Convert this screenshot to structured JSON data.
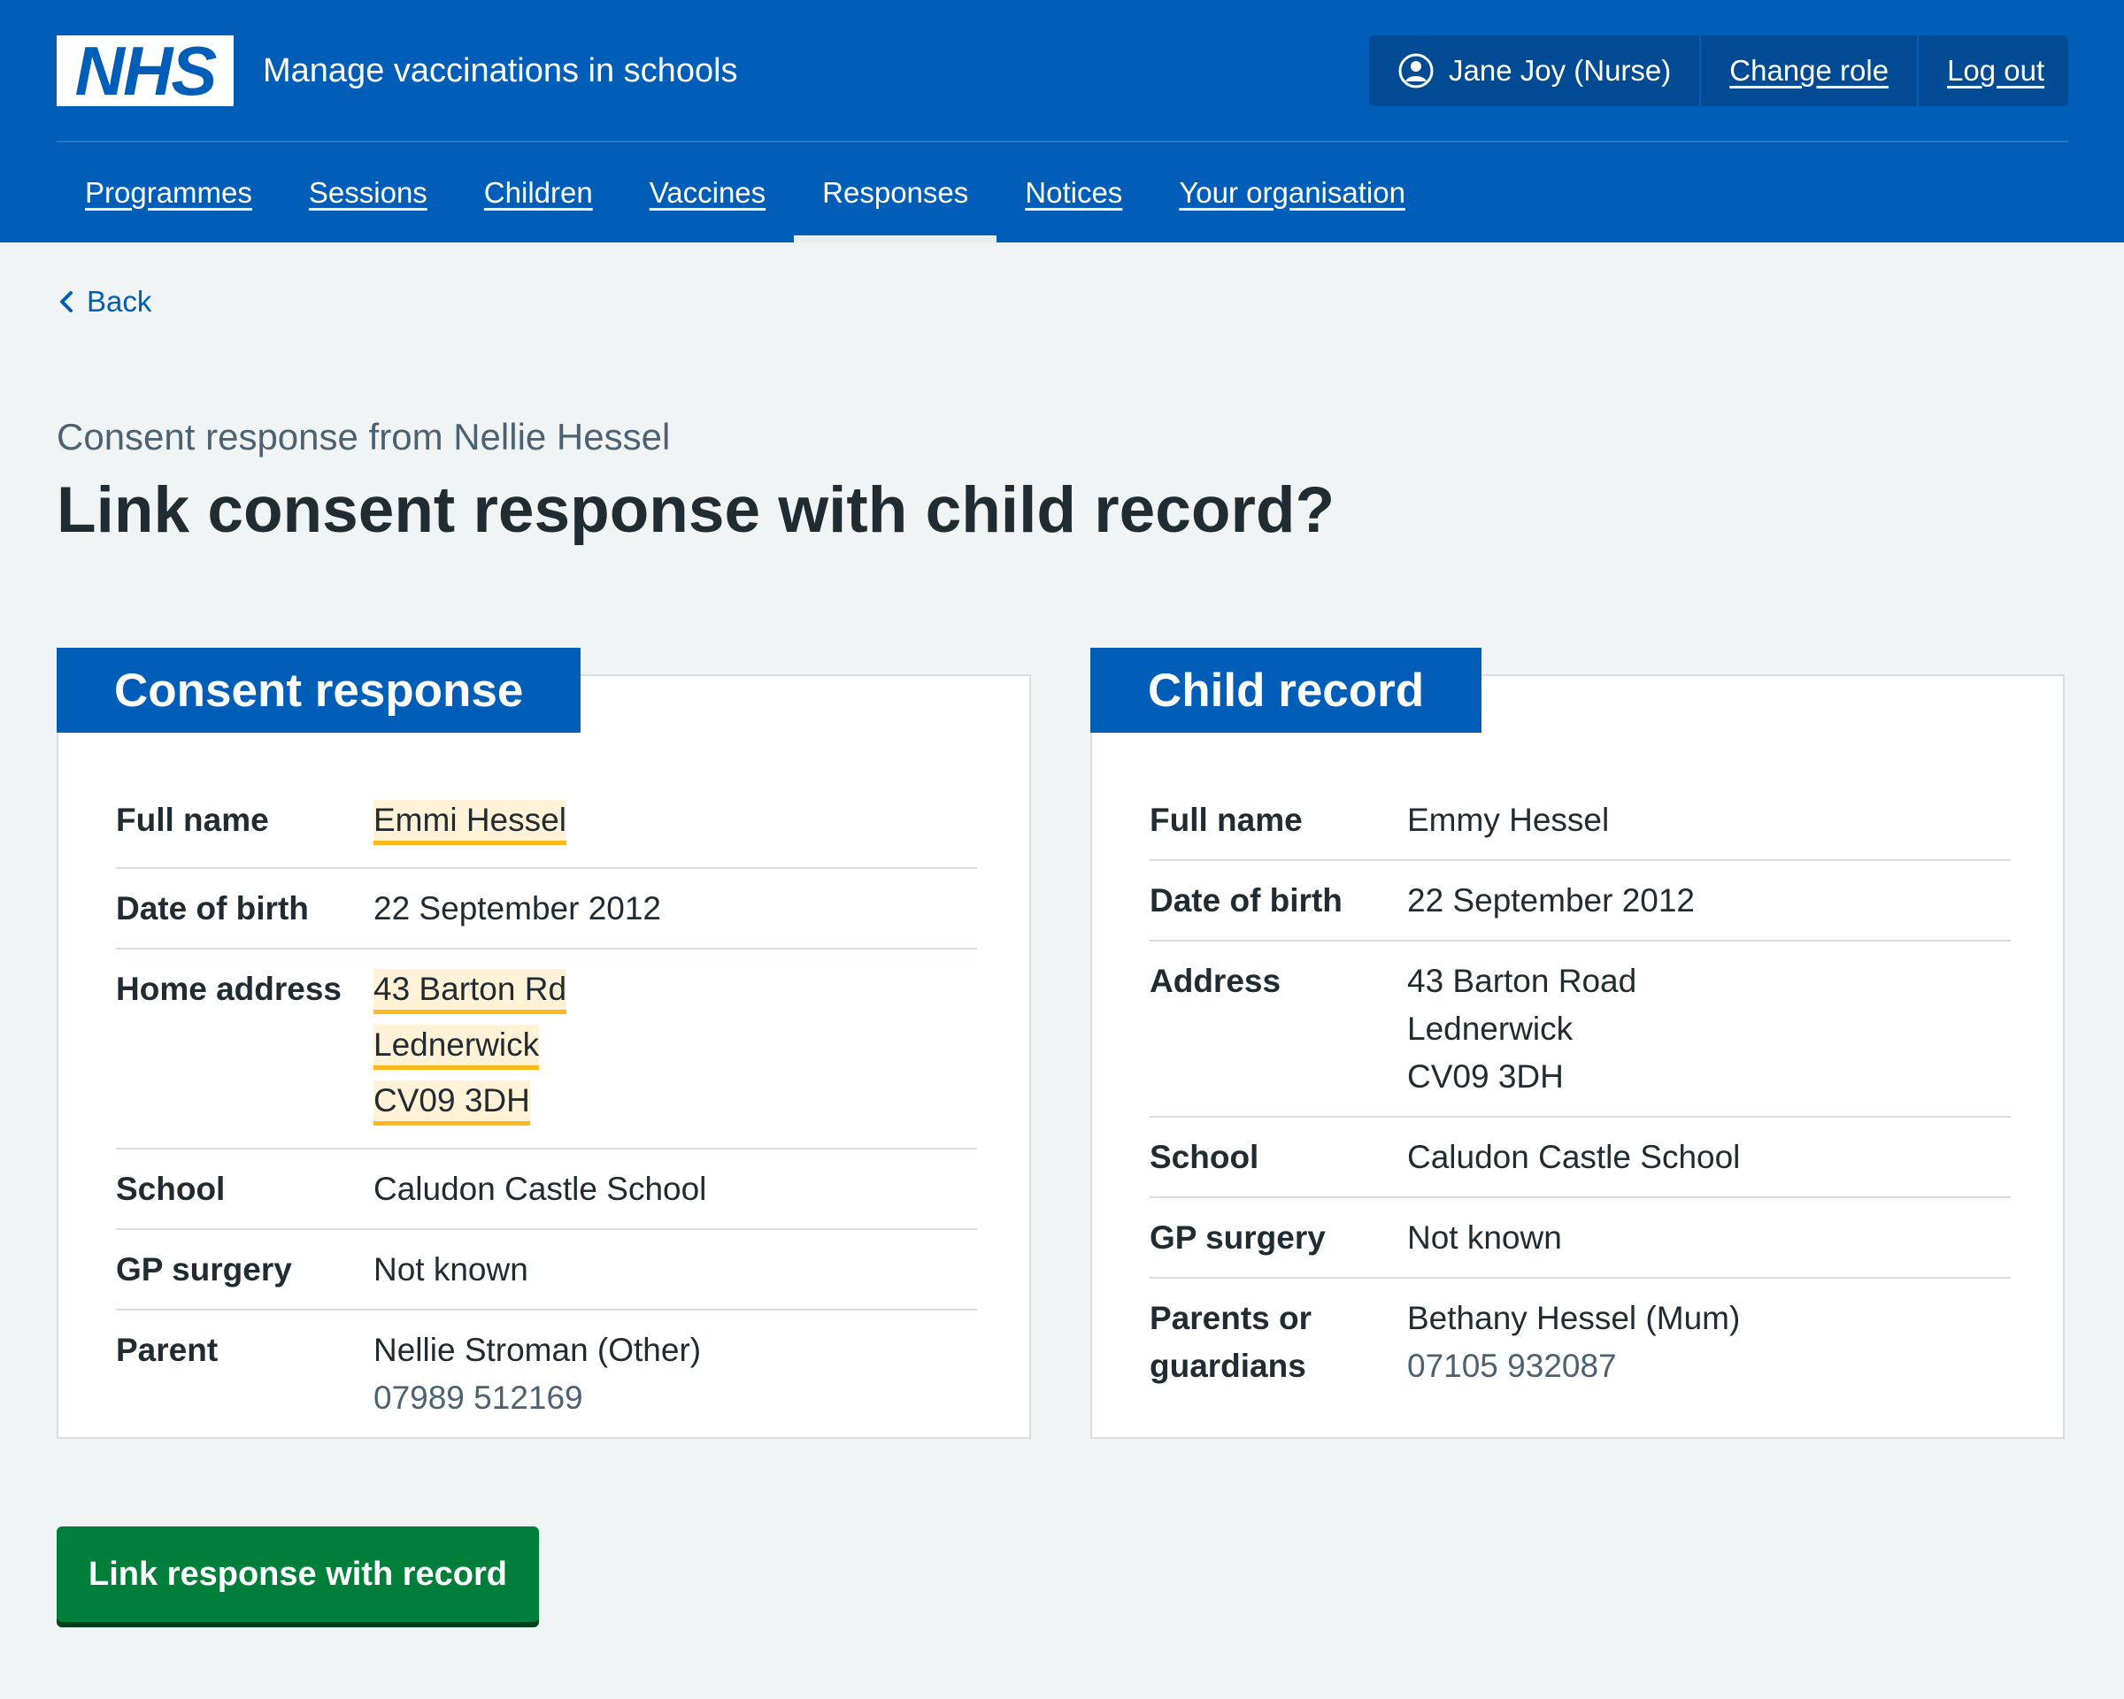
{
  "header": {
    "logo_text": "NHS",
    "service_name": "Manage vaccinations in schools",
    "account": {
      "user": "Jane Joy (Nurse)",
      "change_role": "Change role",
      "log_out": "Log out"
    },
    "nav": [
      {
        "label": "Programmes",
        "active": false
      },
      {
        "label": "Sessions",
        "active": false
      },
      {
        "label": "Children",
        "active": false
      },
      {
        "label": "Vaccines",
        "active": false
      },
      {
        "label": "Responses",
        "active": true
      },
      {
        "label": "Notices",
        "active": false
      },
      {
        "label": "Your organisation",
        "active": false
      }
    ]
  },
  "back_link": "Back",
  "caption": "Consent response from Nellie Hessel",
  "title": "Link consent response with child record?",
  "consent_card": {
    "heading": "Consent response",
    "full_name_label": "Full name",
    "full_name": "Emmi Hessel",
    "dob_label": "Date of birth",
    "dob": "22 September 2012",
    "address_label": "Home address",
    "address_line1": "43 Barton Rd",
    "address_line2": "Lednerwick",
    "address_line3": "CV09 3DH",
    "school_label": "School",
    "school": "Caludon Castle School",
    "gp_label": "GP surgery",
    "gp": "Not known",
    "parent_label": "Parent",
    "parent_name": "Nellie Stroman (Other)",
    "parent_phone": "07989 512169"
  },
  "child_card": {
    "heading": "Child record",
    "full_name_label": "Full name",
    "full_name": "Emmy Hessel",
    "dob_label": "Date of birth",
    "dob": "22 September 2012",
    "address_label": "Address",
    "address_line1": "43 Barton Road",
    "address_line2": "Lednerwick",
    "address_line3": "CV09 3DH",
    "school_label": "School",
    "school": "Caludon Castle School",
    "gp_label": "GP surgery",
    "gp": "Not known",
    "parent_label": "Parents or guardians",
    "parent_name": "Bethany Hessel (Mum)",
    "parent_phone": "07105 932087"
  },
  "submit_button": "Link response with record",
  "colors": {
    "brand_blue": "#005eb8",
    "highlight": "#fff2d7",
    "highlight_border": "#ffb81c",
    "button_green": "#007f3b"
  }
}
